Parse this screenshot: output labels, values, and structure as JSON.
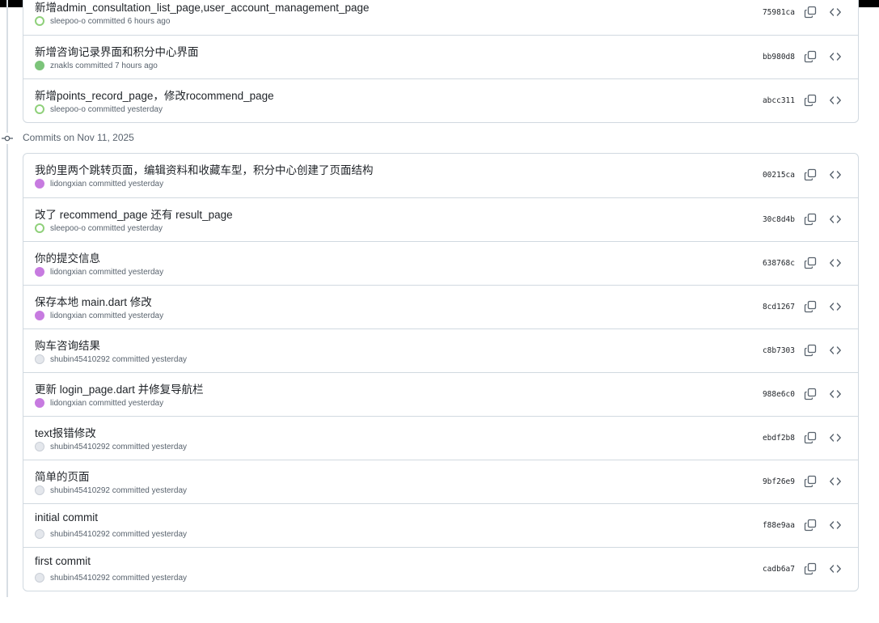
{
  "group_1": {
    "commits": [
      {
        "title": "新增admin_consultation_list_page,user_account_management_page",
        "author": "sleepoo-o",
        "verb": "committed",
        "time": "6 hours ago",
        "sha": "75981ca",
        "avatar": "green"
      },
      {
        "title": "新增咨询记录界面和积分中心界面",
        "author": "znakls",
        "verb": "committed",
        "time": "7 hours ago",
        "sha": "bb980d8",
        "avatar": "greenish"
      },
      {
        "title": "新增points_record_page，修改rocommend_page",
        "author": "sleepoo-o",
        "verb": "committed",
        "time": "yesterday",
        "sha": "abcc311",
        "avatar": "green"
      }
    ]
  },
  "group_2": {
    "header": "Commits on Nov 11, 2025",
    "commits": [
      {
        "title": "我的里两个跳转页面，编辑资料和收藏车型，积分中心创建了页面结构",
        "author": "lidongxian",
        "verb": "committed",
        "time": "yesterday",
        "sha": "00215ca",
        "avatar": "purple"
      },
      {
        "title": "改了 recommend_page 还有 result_page",
        "author": "sleepoo-o",
        "verb": "committed",
        "time": "yesterday",
        "sha": "30c8d4b",
        "avatar": "green"
      },
      {
        "title": "你的提交信息",
        "author": "lidongxian",
        "verb": "committed",
        "time": "yesterday",
        "sha": "638768c",
        "avatar": "purple"
      },
      {
        "title": "保存本地 main.dart 修改",
        "author": "lidongxian",
        "verb": "committed",
        "time": "yesterday",
        "sha": "8cd1267",
        "avatar": "purple"
      },
      {
        "title": "购车咨询结果",
        "author": "shubin45410292",
        "verb": "committed",
        "time": "yesterday",
        "sha": "c8b7303",
        "avatar": "gray"
      },
      {
        "title": "更新 login_page.dart 并修复导航栏",
        "author": "lidongxian",
        "verb": "committed",
        "time": "yesterday",
        "sha": "988e6c0",
        "avatar": "purple"
      },
      {
        "title": "text报错修改",
        "author": "shubin45410292",
        "verb": "committed",
        "time": "yesterday",
        "sha": "ebdf2b8",
        "avatar": "gray"
      },
      {
        "title": "简单的页面",
        "author": "shubin45410292",
        "verb": "committed",
        "time": "yesterday",
        "sha": "9bf26e9",
        "avatar": "gray"
      },
      {
        "title": "initial commit",
        "author": "shubin45410292",
        "verb": "committed",
        "time": "yesterday",
        "sha": "f88e9aa",
        "avatar": "gray"
      },
      {
        "title": "first commit",
        "author": "shubin45410292",
        "verb": "committed",
        "time": "yesterday",
        "sha": "cadb6a7",
        "avatar": "gray"
      }
    ]
  },
  "icons": {
    "commit_node": "git-commit-icon",
    "copy": "copy-icon",
    "browse": "code-icon"
  },
  "colors": {
    "text": "#1f2328",
    "muted": "#59636e",
    "border": "#d1d9e0"
  }
}
